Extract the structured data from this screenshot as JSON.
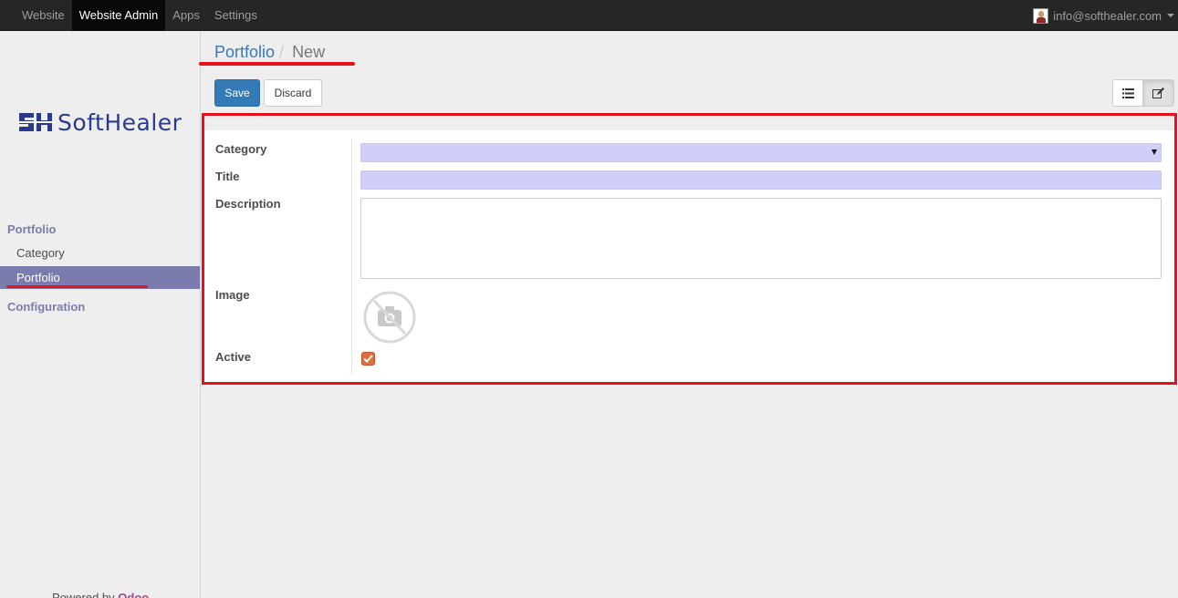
{
  "topbar": {
    "menu": [
      "Website",
      "Website Admin",
      "Apps",
      "Settings"
    ],
    "active_index": 1,
    "user_email": "info@softhealer.com"
  },
  "sidebar": {
    "logo_text": "SoftHealer",
    "sections": [
      {
        "title": "Portfolio",
        "items": [
          {
            "label": "Category",
            "active": false
          },
          {
            "label": "Portfolio",
            "active": true
          }
        ]
      },
      {
        "title": "Configuration",
        "items": []
      }
    ],
    "powered_by_prefix": "Powered by",
    "powered_by_brand": "Odoo"
  },
  "breadcrumb": {
    "parent": "Portfolio",
    "separator": "/",
    "current": "New"
  },
  "toolbar": {
    "save_label": "Save",
    "discard_label": "Discard"
  },
  "form": {
    "fields": {
      "category": {
        "label": "Category",
        "value": ""
      },
      "title": {
        "label": "Title",
        "value": ""
      },
      "description": {
        "label": "Description",
        "value": ""
      },
      "image": {
        "label": "Image",
        "icon": "no-image-camera-icon"
      },
      "active": {
        "label": "Active",
        "checked": true
      }
    }
  },
  "colors": {
    "navbar": "#262626",
    "primary": "#337ab7",
    "sidebar_accent": "#7c7bad",
    "required_field": "#cfcff9",
    "checkbox": "#e06c3f",
    "annotation": "#e8101a",
    "brand_odoo": "#a24689"
  }
}
